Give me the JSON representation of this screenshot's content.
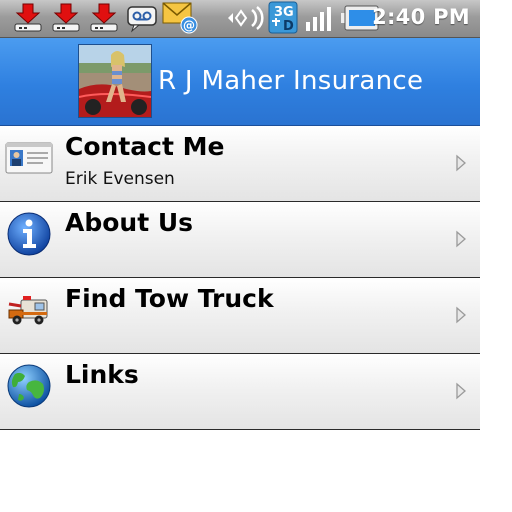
{
  "status_bar": {
    "time": "2:40 PM",
    "network_badge": "3G",
    "icons": [
      "download-icon",
      "download-icon",
      "download-icon",
      "voicemail-icon",
      "email-icon",
      "sync-icon",
      "network-3g-icon",
      "signal-icon",
      "battery-icon"
    ]
  },
  "header": {
    "title": "R J Maher Insurance"
  },
  "menu": {
    "items": [
      {
        "title": "Contact Me",
        "subtitle": "Erik Evensen",
        "icon": "contact-card-icon"
      },
      {
        "title": "About Us",
        "subtitle": "",
        "icon": "info-icon"
      },
      {
        "title": "Find Tow Truck",
        "subtitle": "",
        "icon": "tow-truck-icon"
      },
      {
        "title": "Links",
        "subtitle": "",
        "icon": "globe-icon"
      }
    ]
  },
  "colors": {
    "header_blue": "#2f80e0",
    "status_gray": "#9c9c9c",
    "row_bg": "#eeeeee"
  }
}
